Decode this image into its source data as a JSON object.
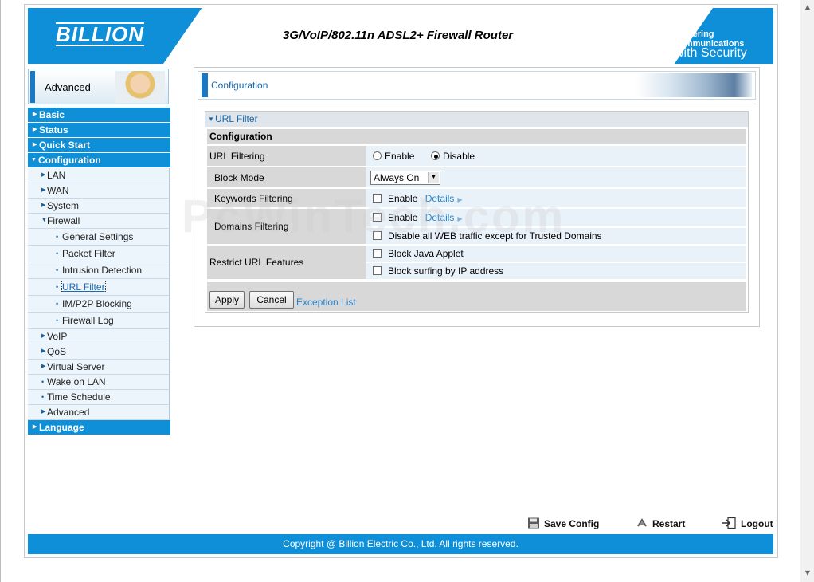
{
  "header": {
    "logo": "BILLION",
    "title": "3G/VoIP/802.11n ADSL2+ Firewall Router",
    "tagline_line1": "Powering communications",
    "tagline_line2": "with Security"
  },
  "sidebar": {
    "banner": "Advanced",
    "items": [
      {
        "label": "Basic",
        "level": 0
      },
      {
        "label": "Status",
        "level": 0
      },
      {
        "label": "Quick Start",
        "level": 0
      },
      {
        "label": "Configuration",
        "level": 0,
        "expanded": true
      },
      {
        "label": "LAN",
        "level": 1
      },
      {
        "label": "WAN",
        "level": 1
      },
      {
        "label": "System",
        "level": 1
      },
      {
        "label": "Firewall",
        "level": 1,
        "expanded": true
      },
      {
        "label": "General Settings",
        "level": 2
      },
      {
        "label": "Packet Filter",
        "level": 2
      },
      {
        "label": "Intrusion Detection",
        "level": 2
      },
      {
        "label": "URL Filter",
        "level": 2,
        "active": true
      },
      {
        "label": "IM/P2P Blocking",
        "level": 2
      },
      {
        "label": "Firewall Log",
        "level": 2
      },
      {
        "label": "VoIP",
        "level": 1
      },
      {
        "label": "QoS",
        "level": 1
      },
      {
        "label": "Virtual Server",
        "level": 1
      },
      {
        "label": "Wake on LAN",
        "level": 1
      },
      {
        "label": "Time Schedule",
        "level": 1
      },
      {
        "label": "Advanced",
        "level": 1
      },
      {
        "label": "Language",
        "level": 0
      }
    ]
  },
  "main": {
    "panel_title": "Configuration",
    "section_title": "URL Filter",
    "sub_title": "Configuration",
    "url_filtering": {
      "label": "URL Filtering",
      "enable": "Enable",
      "disable": "Disable",
      "selected": "Disable"
    },
    "block_mode": {
      "label": "Block Mode",
      "value": "Always On"
    },
    "keywords": {
      "label": "Keywords Filtering",
      "enable": "Enable",
      "details": "Details",
      "checked": false
    },
    "domains": {
      "label": "Domains Filtering",
      "enable": "Enable",
      "details": "Details",
      "trusted": "Disable all WEB traffic except for Trusted Domains"
    },
    "restrict": {
      "label": "Restrict URL Features",
      "java": "Block Java Applet",
      "ip": "Block surfing by IP address"
    },
    "apply": "Apply",
    "cancel": "Cancel",
    "exception_list": "Exception List"
  },
  "toolbar": {
    "save": "Save Config",
    "restart": "Restart",
    "logout": "Logout"
  },
  "footer": "Copyright @ Billion Electric Co., Ltd. All rights reserved.",
  "watermark": "PcWinTech.com",
  "colors": {
    "brand": "#0e8fd7",
    "link": "#2a86cf"
  }
}
